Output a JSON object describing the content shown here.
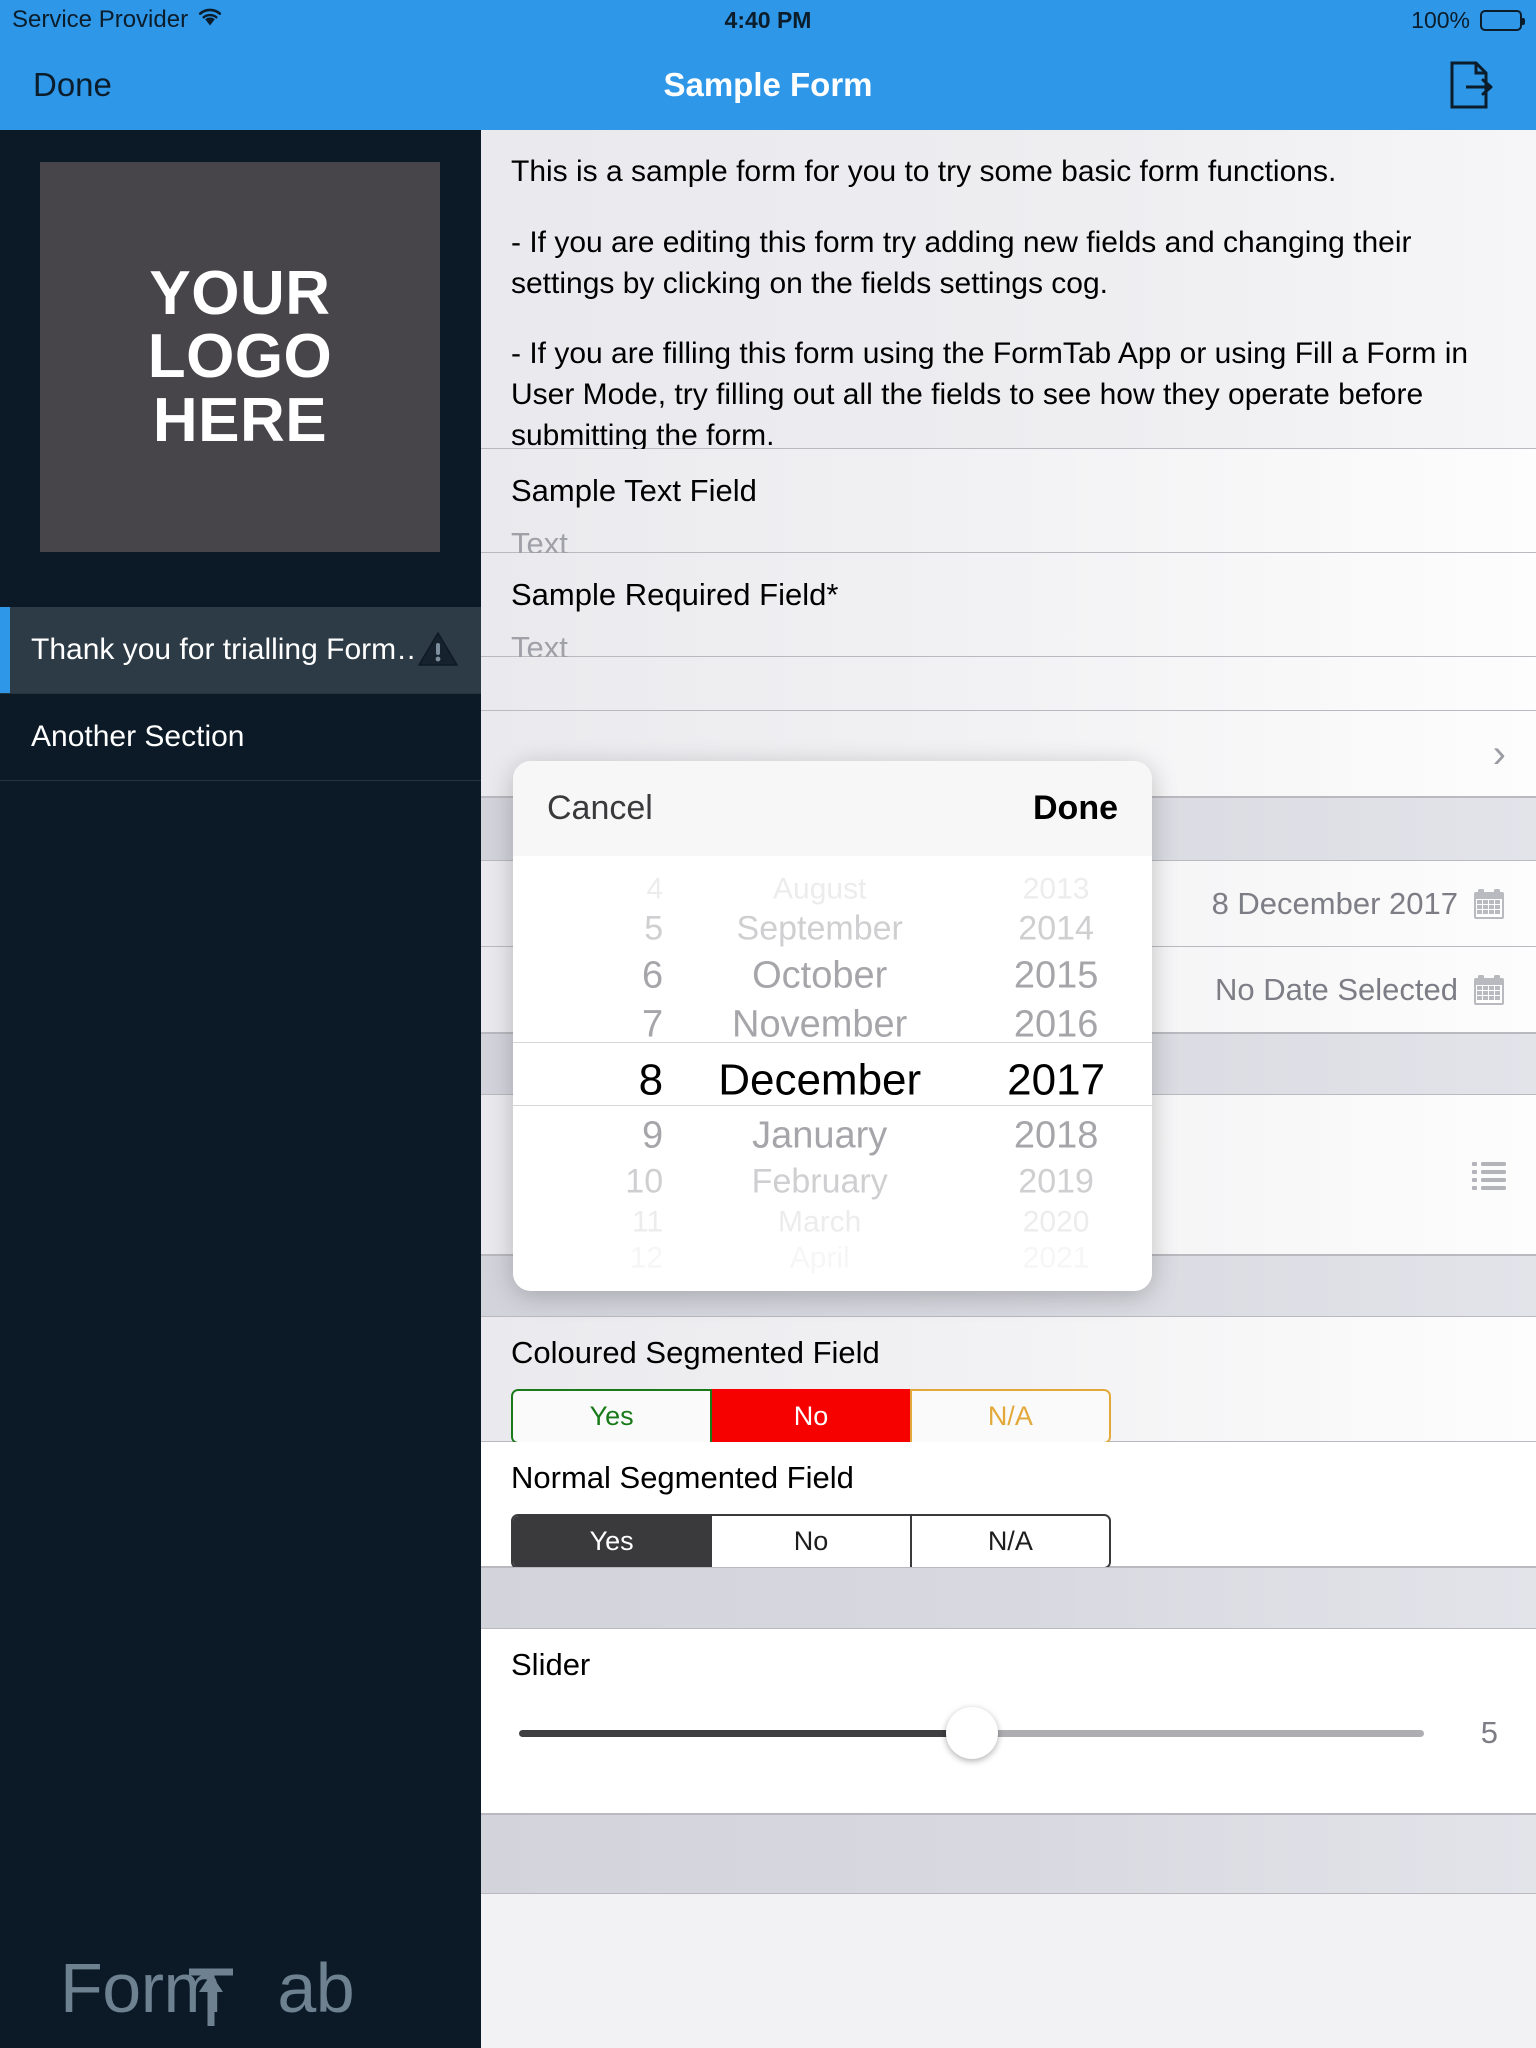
{
  "status_bar": {
    "carrier": "Service Provider",
    "wifi_icon": "wifi-icon",
    "time": "4:40 PM",
    "battery_percent": "100%",
    "battery_icon": "battery-full-icon"
  },
  "nav_bar": {
    "done_label": "Done",
    "title": "Sample Form",
    "export_icon": "document-export-icon"
  },
  "sidebar": {
    "logo_placeholder": "YOUR\nLOGO\nHERE",
    "logo_line1": "YOUR",
    "logo_line2": "LOGO",
    "logo_line3": "HERE",
    "sections": [
      {
        "label": "Thank you for trialling Form…",
        "active": true,
        "warning_icon": "warning-triangle-icon"
      },
      {
        "label": "Another Section",
        "active": false,
        "warning_icon": ""
      }
    ],
    "brand": "FormTab",
    "brand_part1": "Form",
    "brand_part2": "ab",
    "brand_letter_t": "T"
  },
  "form": {
    "intro_paragraphs": [
      "This is a sample form for you to try some basic form functions.",
      " - If you are editing this form try adding new fields and changing their settings by clicking on the fields settings cog.",
      " - If you are filling this form using the FormTab App or using Fill a Form in User Mode, try filling out all the fields to see how they operate before submitting the form."
    ],
    "intro_p1": "This is a sample form for you to try some basic form functions.",
    "intro_p2": " - If you are editing this form try adding new fields and changing their settings by clicking on the fields settings cog.",
    "intro_p3": " - If you are filling this form using the FormTab App or using Fill a Form in User Mode, try filling out all the fields to see how they operate before submitting the form.",
    "fields": {
      "text_field": {
        "label": "Sample Text Field",
        "placeholder": "Text",
        "value": ""
      },
      "required_field": {
        "label": "Sample Required Field*",
        "placeholder": "Text",
        "value": ""
      },
      "disclosure_row": {
        "chevron_icon": "chevron-right-icon"
      },
      "date_field": {
        "value": "8 December 2017",
        "icon": "calendar-icon"
      },
      "date_field_empty": {
        "value": "No Date Selected",
        "icon": "calendar-icon"
      },
      "list_field": {
        "icon": "list-bullets-icon"
      },
      "coloured_segment": {
        "label": "Coloured Segmented Field",
        "options": [
          "Yes",
          "No",
          "N/A"
        ],
        "selected_index": 1,
        "colors": {
          "yes": "#1a7a1a",
          "no": "#f60000",
          "na": "#e2a93a"
        }
      },
      "normal_segment": {
        "label": "Normal Segmented Field",
        "options": [
          "Yes",
          "No",
          "N/A"
        ],
        "selected_index": 0,
        "selected_color": "#3a3a3c"
      },
      "slider": {
        "label": "Slider",
        "value": "5",
        "percent": 50
      }
    }
  },
  "date_picker": {
    "cancel_label": "Cancel",
    "done_label": "Done",
    "days": [
      "4",
      "5",
      "6",
      "7",
      "8",
      "9",
      "10",
      "11",
      "12"
    ],
    "months": [
      "August",
      "September",
      "October",
      "November",
      "December",
      "January",
      "February",
      "March",
      "April"
    ],
    "years": [
      "2013",
      "2014",
      "2015",
      "2016",
      "2017",
      "2018",
      "2019",
      "2020",
      "2021"
    ],
    "selected_day": "8",
    "selected_month": "December",
    "selected_year": "2017"
  },
  "colors": {
    "accent_blue": "#2e97e8",
    "sidebar_dark": "#0b1a26",
    "sidebar_active": "#2c3b46"
  }
}
